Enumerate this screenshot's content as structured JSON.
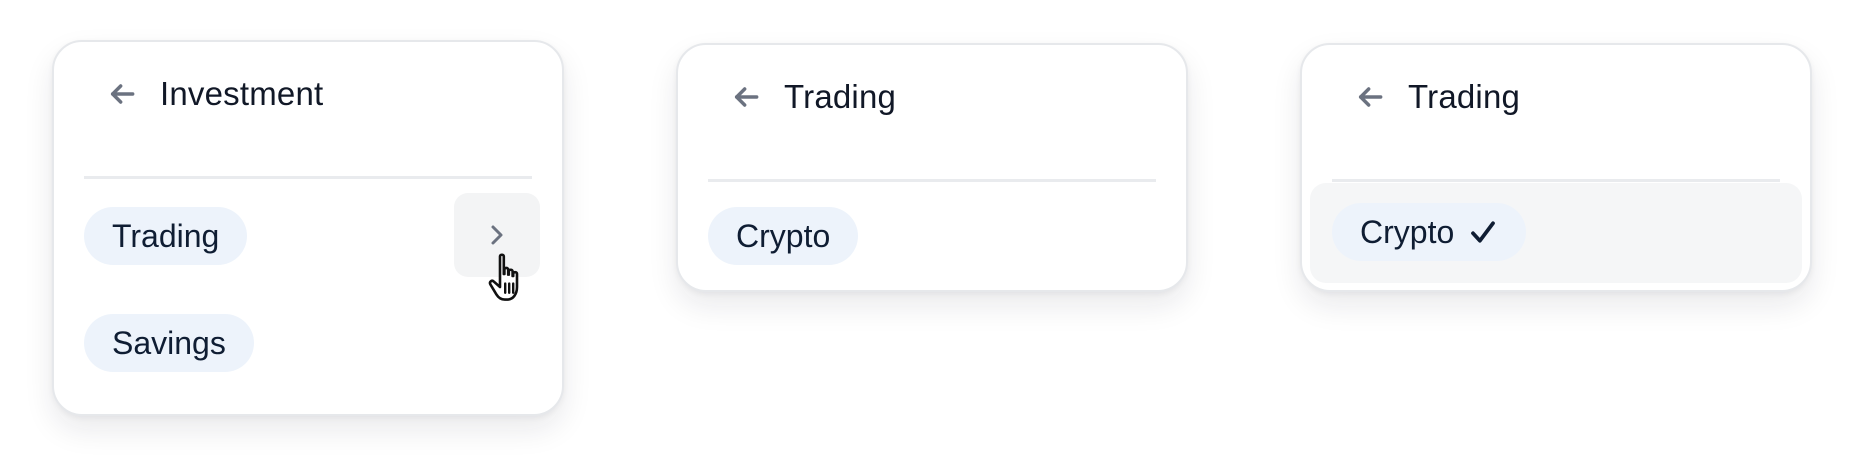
{
  "cards": [
    {
      "title": "Investment",
      "items": [
        {
          "label": "Trading",
          "has_submenu": true
        },
        {
          "label": "Savings"
        }
      ]
    },
    {
      "title": "Trading",
      "items": [
        {
          "label": "Crypto"
        }
      ]
    },
    {
      "title": "Trading",
      "items": [
        {
          "label": "Crypto",
          "selected": true,
          "check": "✓"
        }
      ]
    }
  ],
  "icons": {
    "back": "arrow-left-icon",
    "submenu": "chevron-right-icon",
    "selected": "check-icon",
    "pointer": "hand-pointer-cursor-icon"
  },
  "colors": {
    "pill_background": "#edf3fb",
    "pill_text": "#0f1d33",
    "icon_gray": "#6b7280",
    "divider": "#e9ebee",
    "selected_row": "#f5f6f7"
  }
}
